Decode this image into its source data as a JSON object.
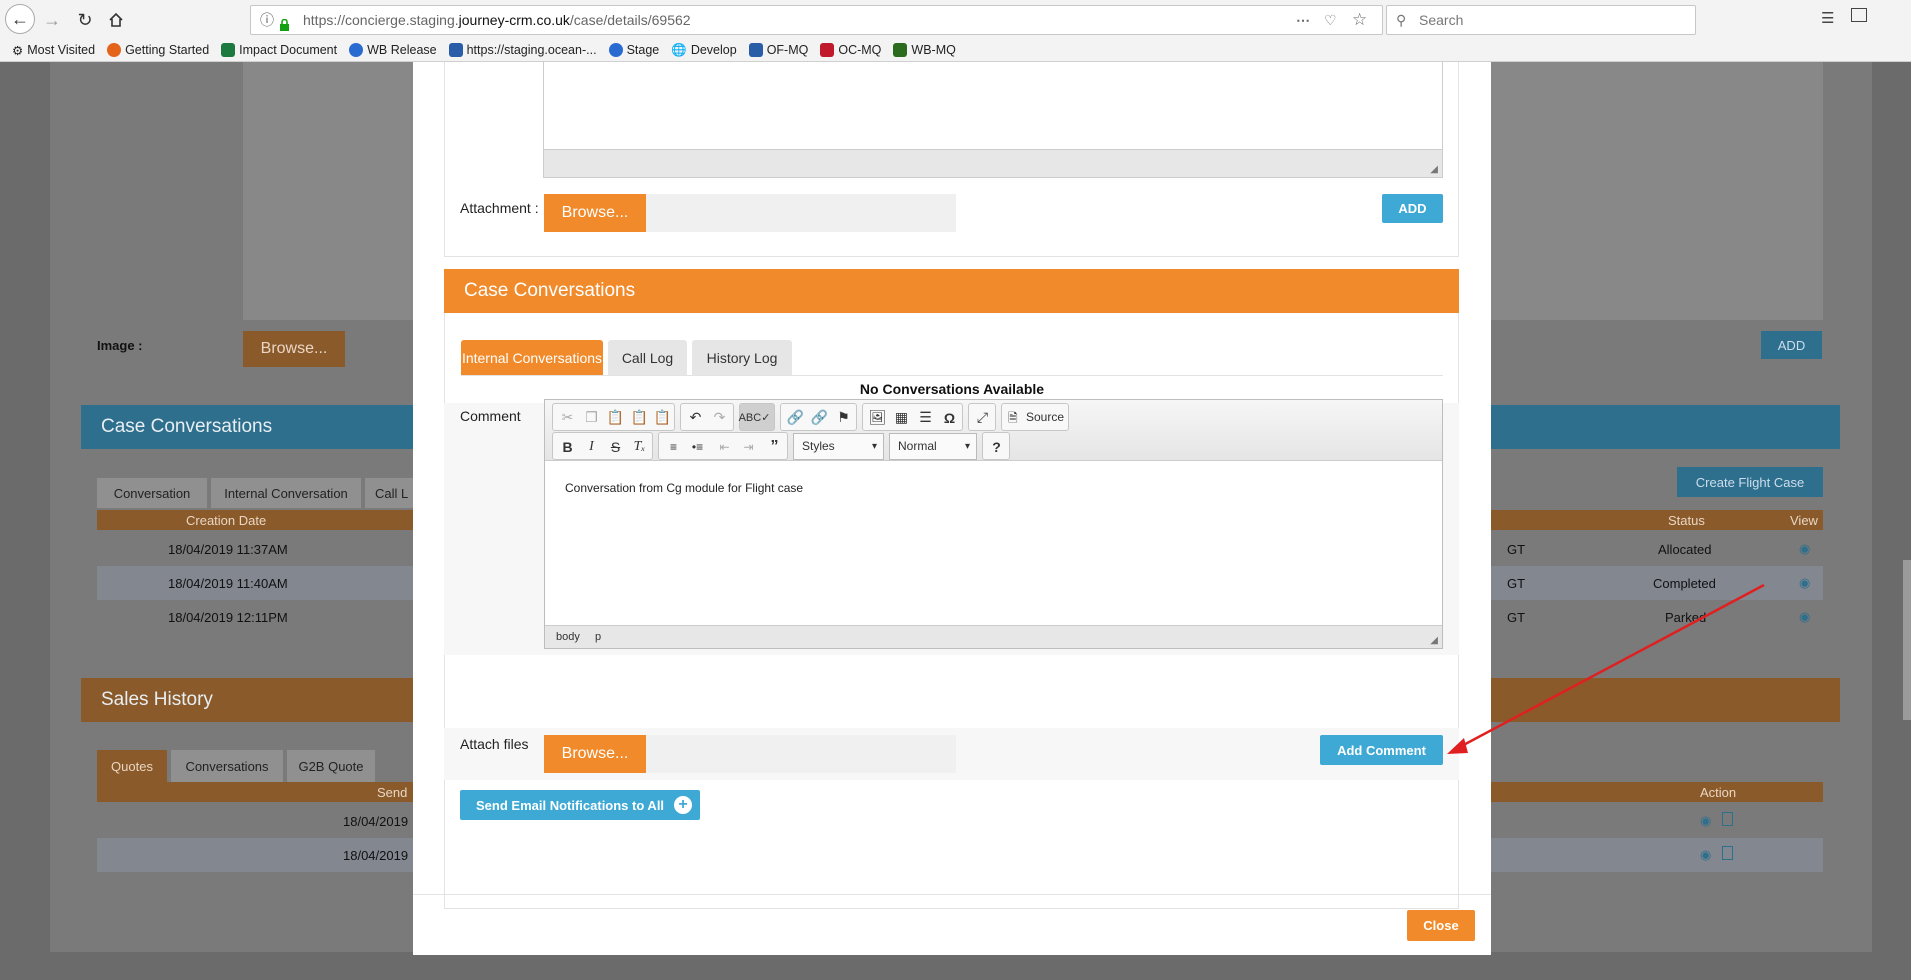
{
  "browser": {
    "url_prefix": "https://concierge.staging.",
    "url_domain": "journey-crm.co.uk",
    "url_path": "/case/details/69562",
    "search_placeholder": "Search",
    "bookmarks": [
      "Most Visited",
      "Getting Started",
      "Impact Document",
      "WB Release",
      "https://staging.ocean-...",
      "Stage",
      "Develop",
      "OF-MQ",
      "OC-MQ",
      "WB-MQ"
    ]
  },
  "background": {
    "image_label": "Image :",
    "browse": "Browse...",
    "add": "ADD",
    "case_conversations_title": "Case Conversations",
    "tabs": [
      "Conversation",
      "Internal Conversation",
      "Call L"
    ],
    "create_flight_case": "Create Flight Case",
    "table_headers": {
      "creation_date": "Creation Date",
      "status": "Status",
      "view": "View"
    },
    "rows": [
      {
        "date": "18/04/2019 11:37AM",
        "mid": "GT",
        "status": "Allocated"
      },
      {
        "date": "18/04/2019 11:40AM",
        "mid": "GT",
        "status": "Completed"
      },
      {
        "date": "18/04/2019 12:11PM",
        "mid": "GT",
        "status": "Parked"
      }
    ],
    "sales_history_title": "Sales History",
    "sales_tabs": [
      "Quotes",
      "Conversations",
      "G2B Quote"
    ],
    "sales_headers": {
      "send": "Send",
      "action": "Action"
    },
    "sales_rows": [
      "18/04/2019",
      "18/04/2019"
    ]
  },
  "modal": {
    "attachment_label": "Attachment :",
    "browse": "Browse...",
    "add": "ADD",
    "case_conversations_title": "Case Conversations",
    "tabs": [
      "Internal Conversations",
      "Call Log",
      "History Log"
    ],
    "no_conversations": "No Conversations Available",
    "comment_label": "Comment",
    "source_label": "Source",
    "styles_label": "Styles",
    "format_label": "Normal",
    "editor_text": "Conversation from Cg module for Flight case",
    "path_body": "body",
    "path_p": "p",
    "attach_files_label": "Attach files",
    "add_comment": "Add Comment",
    "send_email": "Send Email Notifications to All",
    "close": "Close"
  },
  "colors": {
    "orange": "#f08a2a",
    "blue": "#3fa9d6",
    "arrow": "#e02020"
  }
}
